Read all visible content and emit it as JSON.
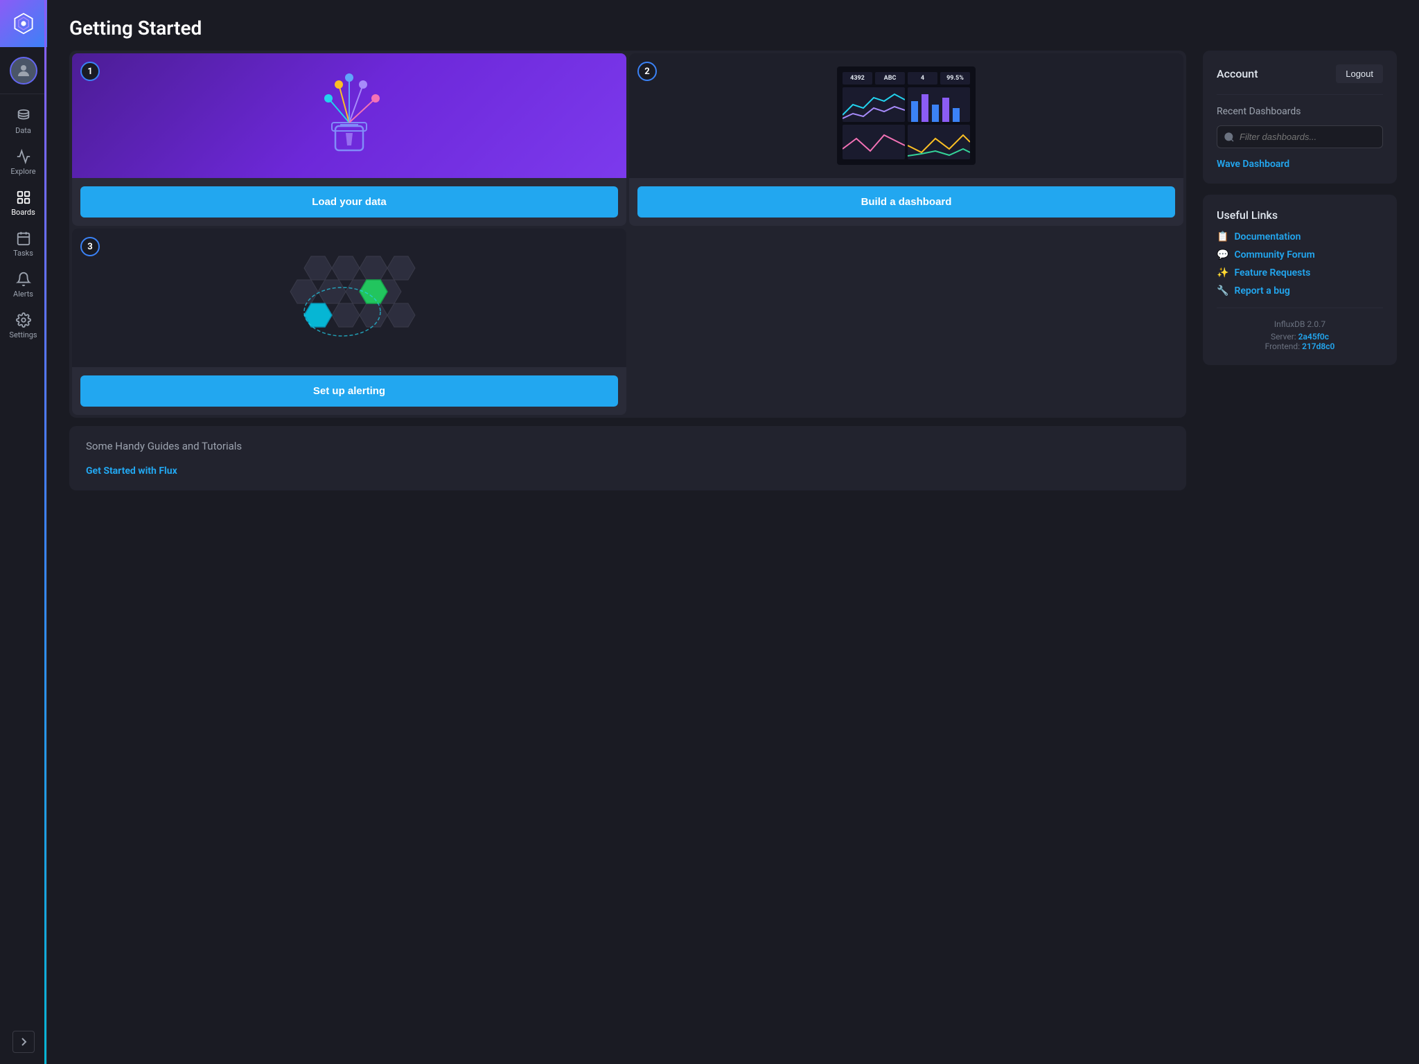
{
  "page": {
    "title": "Getting Started"
  },
  "sidebar": {
    "logo_alt": "InfluxDB Logo",
    "nav_items": [
      {
        "id": "data",
        "label": "Data",
        "icon": "data-icon",
        "active": false
      },
      {
        "id": "explore",
        "label": "Explore",
        "icon": "explore-icon",
        "active": false
      },
      {
        "id": "boards",
        "label": "Boards",
        "icon": "boards-icon",
        "active": true
      },
      {
        "id": "tasks",
        "label": "Tasks",
        "icon": "tasks-icon",
        "active": false
      },
      {
        "id": "alerts",
        "label": "Alerts",
        "icon": "alerts-icon",
        "active": false
      },
      {
        "id": "settings",
        "label": "Settings",
        "icon": "settings-icon",
        "active": false
      }
    ]
  },
  "steps": [
    {
      "number": "1",
      "button_label": "Load your data"
    },
    {
      "number": "2",
      "button_label": "Build a dashboard"
    },
    {
      "number": "3",
      "button_label": "Set up alerting"
    }
  ],
  "guides": {
    "section_title": "Some Handy Guides and Tutorials",
    "links": [
      {
        "label": "Get Started with Flux"
      }
    ]
  },
  "account": {
    "section_title": "Account",
    "logout_label": "Logout"
  },
  "recent_dashboards": {
    "section_title": "Recent Dashboards",
    "filter_placeholder": "Filter dashboards...",
    "items": [
      {
        "label": "Wave Dashboard"
      }
    ]
  },
  "useful_links": {
    "section_title": "Useful Links",
    "items": [
      {
        "icon": "📋",
        "label": "Documentation"
      },
      {
        "icon": "💬",
        "label": "Community Forum"
      },
      {
        "icon": "✨",
        "label": "Feature Requests"
      },
      {
        "icon": "🔧",
        "label": "Report a bug"
      }
    ]
  },
  "version": {
    "db": "InfluxDB 2.0.7",
    "server_label": "Server:",
    "server_hash": "2a45f0c",
    "frontend_label": "Frontend:",
    "frontend_hash": "217d8c0"
  }
}
